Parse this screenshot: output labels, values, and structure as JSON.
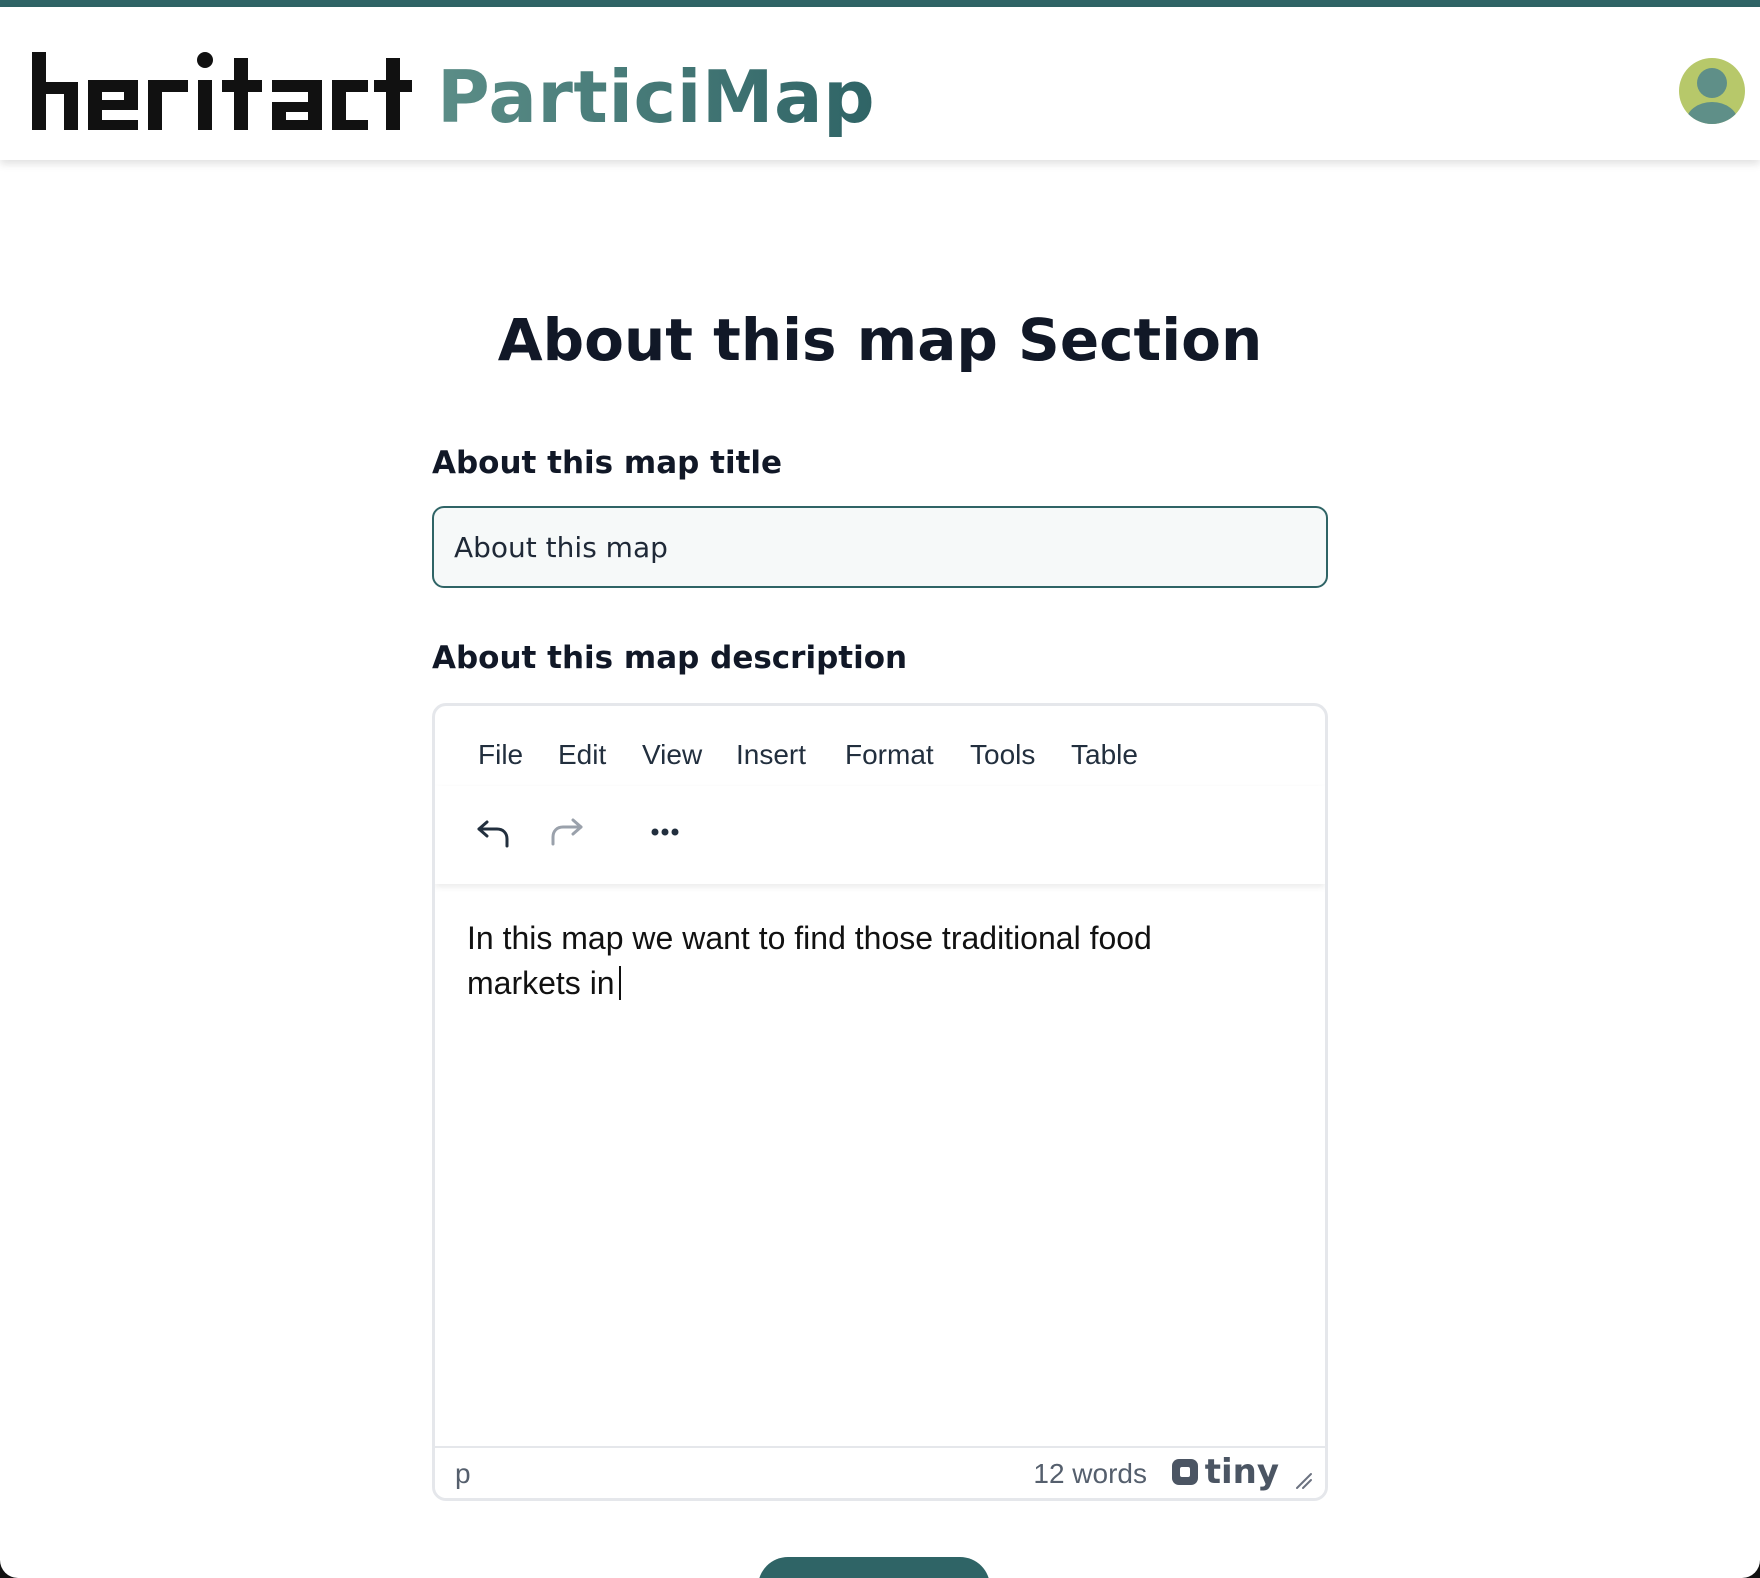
{
  "header": {
    "logo_text": "heritact",
    "app_name": "ParticiMap"
  },
  "page": {
    "title": "About this map Section"
  },
  "form": {
    "title_field": {
      "label": "About this map title",
      "value": "About this map"
    },
    "description_field": {
      "label": "About this map description"
    }
  },
  "editor": {
    "menu": [
      "File",
      "Edit",
      "View",
      "Insert",
      "Format",
      "Tools",
      "Table"
    ],
    "toolbar_icons": [
      "undo-icon",
      "redo-icon",
      "more-icon"
    ],
    "content": "In this map we want to find those traditional food markets in",
    "status": {
      "path": "p",
      "word_count": "12 words",
      "brand": "tiny"
    }
  },
  "colors": {
    "primary": "#2f6466",
    "avatar_bg": "#b7c86a",
    "avatar_fg": "#5f8f88",
    "text_dark": "#111827"
  }
}
